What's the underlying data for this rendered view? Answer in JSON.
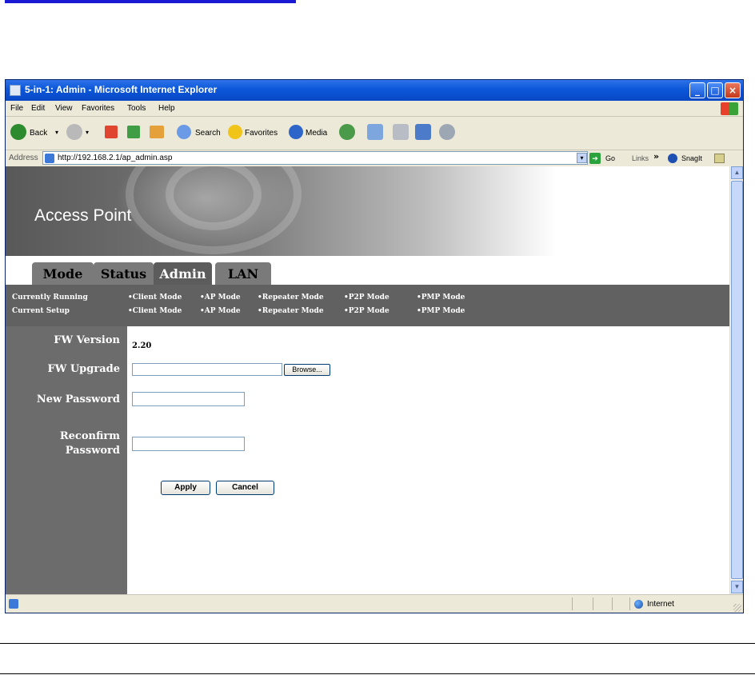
{
  "window": {
    "title": "5-in-1: Admin - Microsoft Internet Explorer",
    "controls": {
      "minimize": "_",
      "maximize": "□",
      "close": "×"
    }
  },
  "menu": [
    "File",
    "Edit",
    "View",
    "Favorites",
    "Tools",
    "Help"
  ],
  "toolbar": {
    "back": "Back",
    "search": "Search",
    "favorites": "Favorites",
    "media": "Media"
  },
  "address": {
    "label": "Address",
    "url": "http://192.168.2.1/ap_admin.asp",
    "go": "Go",
    "links": "Links",
    "chevron": "»",
    "snagit": "SnagIt"
  },
  "banner": {
    "title": "Access Point"
  },
  "tabs": [
    "Mode",
    "Status",
    "Admin",
    "LAN"
  ],
  "active_tab": "Admin",
  "modes": {
    "currently_running_label": "Currently Running",
    "current_setup_label": "Current Setup",
    "items": [
      "•Client Mode",
      "•AP Mode",
      "•Repeater Mode",
      "•P2P Mode",
      "•PMP Mode"
    ]
  },
  "form": {
    "fw_version_label": "FW Version",
    "fw_version_value": "2.20",
    "fw_upgrade_label": "FW Upgrade",
    "browse_label": "Browse...",
    "new_password_label": "New Password",
    "reconfirm_label_line1": "Reconfirm",
    "reconfirm_label_line2": "Password",
    "apply_label": "Apply",
    "cancel_label": "Cancel"
  },
  "status": {
    "zone": "Internet"
  },
  "colors": {
    "titlebar": "#0b57d9",
    "page_gray": "#616161",
    "left_column": "#6c6c6c",
    "active_tab": "#5c5c5c"
  }
}
